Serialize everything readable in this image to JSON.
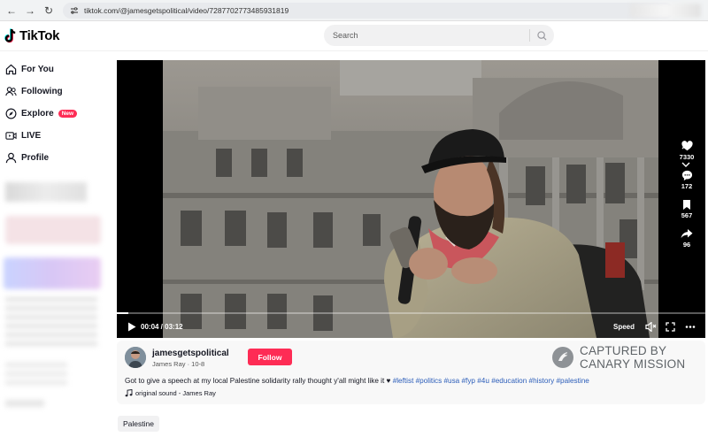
{
  "browser": {
    "url": "tiktok.com/@jamesgetspolitical/video/7287702773485931819"
  },
  "header": {
    "logo_text": "TikTok",
    "search_placeholder": "Search"
  },
  "sidebar": {
    "items": [
      {
        "label": "For You",
        "icon": "home-icon"
      },
      {
        "label": "Following",
        "icon": "people-icon"
      },
      {
        "label": "Explore",
        "icon": "compass-icon",
        "badge": "New"
      },
      {
        "label": "LIVE",
        "icon": "live-icon"
      },
      {
        "label": "Profile",
        "icon": "person-icon"
      }
    ]
  },
  "player": {
    "time": "00:04 / 03:12",
    "speed_label": "Speed",
    "progress": 0.02,
    "actions": [
      {
        "icon": "heart-icon",
        "count": "7330"
      },
      {
        "icon": "comment-icon",
        "count": "172"
      },
      {
        "icon": "bookmark-icon",
        "count": "567"
      },
      {
        "icon": "share-icon",
        "count": "96"
      }
    ]
  },
  "post": {
    "username": "jamesgetspolitical",
    "display_name_date": "James Ray · 10-8",
    "follow_label": "Follow",
    "caption_text": "Got to give a speech at my local Palestine solidarity rally thought y'all might like it ♥ ",
    "hashtags": "#leftist #politics #usa #fyp #4u #education #history #palestine",
    "sound": "original sound - James Ray",
    "watermark_line1": "CAPTURED BY",
    "watermark_line2": "CANARY MISSION"
  },
  "related_chip": "Palestine",
  "colors": {
    "brand": "#fe2c55",
    "hashtag": "#2b5db9",
    "text": "#161823"
  }
}
